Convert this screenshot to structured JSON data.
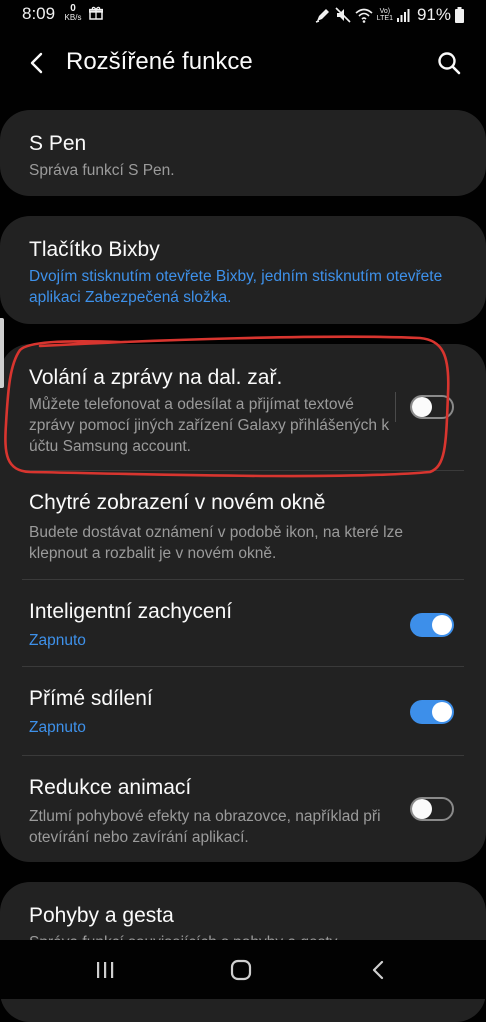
{
  "status_bar": {
    "time": "8:09",
    "net_speed_value": "0",
    "net_speed_unit": "KB/s",
    "volte_label": "Vo)",
    "lte_label": "LTE1",
    "battery": "91%"
  },
  "header": {
    "title": "Rozšířené funkce"
  },
  "cards": {
    "spen": {
      "title": "S Pen",
      "desc": "Správa funkcí S Pen."
    },
    "bixby": {
      "title": "Tlačítko Bixby",
      "desc": "Dvojím stisknutím otevřete Bixby, jedním stisknutím otevřete aplikaci Zabezpečená složka."
    },
    "main": {
      "items": [
        {
          "title": "Volání a zprávy na dal. zař.",
          "desc": "Můžete telefonovat a odesílat a přijímat textové zprávy pomocí jiných zařízení Galaxy přihlášených k účtu Samsung account.",
          "toggle": false
        },
        {
          "title": "Chytré zobrazení v novém okně",
          "desc": "Budete dostávat oznámení v podobě ikon, na které lze klepnout a rozbalit je v novém okně."
        },
        {
          "title": "Inteligentní zachycení",
          "desc": "Zapnuto",
          "toggle": true
        },
        {
          "title": "Přímé sdílení",
          "desc": "Zapnuto",
          "toggle": true
        },
        {
          "title": "Redukce animací",
          "desc": "Ztlumí pohybové efekty na obrazovce, například při otevírání nebo zavírání aplikací.",
          "toggle": false
        }
      ]
    },
    "motions": {
      "title": "Pohyby a gesta",
      "desc": "Správa funkcí souvisejících s pohyby a gesty."
    }
  },
  "colors": {
    "accent_blue": "#3d8fea",
    "annotation_red": "#d8352f",
    "card_bg": "#222222",
    "page_bg": "#010101"
  },
  "icons": {
    "back": "chevron-left-icon",
    "search": "search-icon",
    "recents": "recents-icon",
    "home": "home-icon",
    "nav_back": "nav-back-icon"
  }
}
